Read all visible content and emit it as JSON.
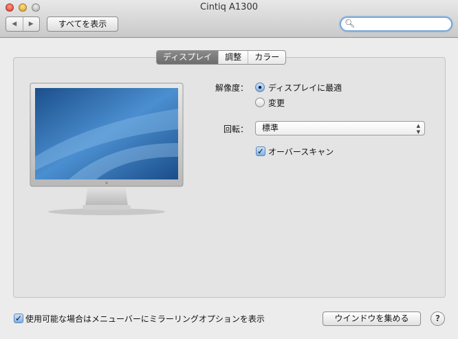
{
  "window": {
    "title": "Cintiq A1300"
  },
  "toolbar": {
    "back": "◀",
    "forward": "▶",
    "show_all": "すべてを表示",
    "search_placeholder": "",
    "search_icon": "⚲"
  },
  "tabs": [
    {
      "label": "ディスプレイ",
      "active": true
    },
    {
      "label": "調整",
      "active": false
    },
    {
      "label": "カラー",
      "active": false
    }
  ],
  "display": {
    "resolution_label": "解像度：",
    "resolution_options": [
      {
        "label": "ディスプレイに最適",
        "selected": true
      },
      {
        "label": "変更",
        "selected": false
      }
    ],
    "rotation_label": "回転：",
    "rotation_value": "標準",
    "overscan_label": "オーバースキャン",
    "overscan_checked": true
  },
  "footer": {
    "mirror_label": "使用可能な場合はメニューバーにミラーリングオプションを表示",
    "mirror_checked": true,
    "gather_windows": "ウインドウを集める",
    "help": "?"
  }
}
